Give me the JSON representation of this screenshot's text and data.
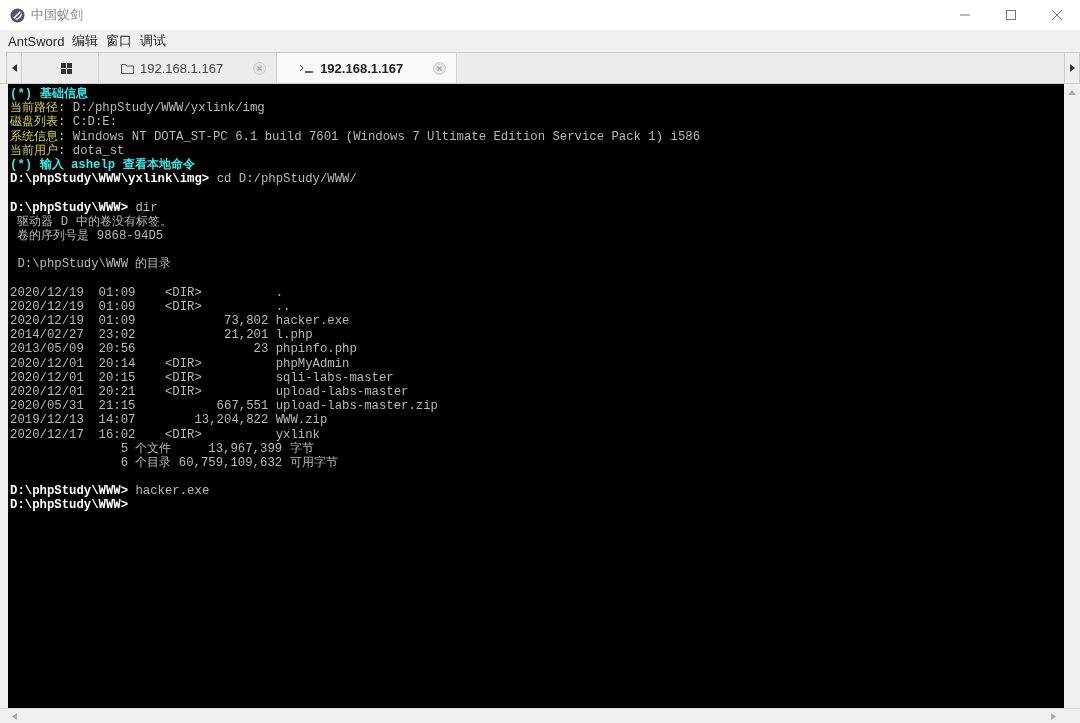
{
  "window": {
    "title": "中国蚁剑"
  },
  "menu": [
    "AntSword",
    "编辑",
    "窗口",
    "调试"
  ],
  "tabs": [
    {
      "kind": "home",
      "selected": false
    },
    {
      "kind": "files",
      "label": "192.168.1.167",
      "selected": false
    },
    {
      "kind": "terminal",
      "label": "192.168.1.167",
      "selected": true
    }
  ],
  "terminal": {
    "lines": [
      {
        "kind": "header",
        "text": "(*) 基础信息"
      },
      {
        "kind": "info",
        "label": "当前路径:",
        "value": "D:/phpStudy/WWW/yxlink/img"
      },
      {
        "kind": "info",
        "label": "磁盘列表:",
        "value": "C:D:E:"
      },
      {
        "kind": "info",
        "label": "系统信息:",
        "value": "Windows NT DOTA_ST-PC 6.1 build 7601 (Windows 7 Ultimate Edition Service Pack 1) i586"
      },
      {
        "kind": "info",
        "label": "当前用户:",
        "value": "dota_st"
      },
      {
        "kind": "header",
        "text": "(*) 输入 ashelp 查看本地命令"
      },
      {
        "kind": "prompt",
        "prompt": "D:\\phpStudy\\WWW\\yxlink\\img>",
        "command": "cd D:/phpStudy/WWW/"
      },
      {
        "kind": "blank"
      },
      {
        "kind": "prompt",
        "prompt": "D:\\phpStudy\\WWW>",
        "command": "dir"
      },
      {
        "kind": "output",
        "text": " 驱动器 D 中的卷没有标签。"
      },
      {
        "kind": "output",
        "text": " 卷的序列号是 9868-94D5"
      },
      {
        "kind": "blank"
      },
      {
        "kind": "output",
        "text": " D:\\phpStudy\\WWW 的目录"
      },
      {
        "kind": "blank"
      },
      {
        "kind": "output",
        "text": "2020/12/19  01:09    <DIR>          ."
      },
      {
        "kind": "output",
        "text": "2020/12/19  01:09    <DIR>          .."
      },
      {
        "kind": "output",
        "text": "2020/12/19  01:09            73,802 hacker.exe"
      },
      {
        "kind": "output",
        "text": "2014/02/27  23:02            21,201 l.php"
      },
      {
        "kind": "output",
        "text": "2013/05/09  20:56                23 phpinfo.php"
      },
      {
        "kind": "output",
        "text": "2020/12/01  20:14    <DIR>          phpMyAdmin"
      },
      {
        "kind": "output",
        "text": "2020/12/01  20:15    <DIR>          sqli-labs-master"
      },
      {
        "kind": "output",
        "text": "2020/12/01  20:21    <DIR>          upload-labs-master"
      },
      {
        "kind": "output",
        "text": "2020/05/31  21:15           667,551 upload-labs-master.zip"
      },
      {
        "kind": "output",
        "text": "2019/12/13  14:07        13,204,822 WWW.zip"
      },
      {
        "kind": "output",
        "text": "2020/12/17  16:02    <DIR>          yxlink"
      },
      {
        "kind": "output",
        "text": "               5 个文件     13,967,399 字节"
      },
      {
        "kind": "output",
        "text": "               6 个目录 60,759,109,632 可用字节"
      },
      {
        "kind": "blank"
      },
      {
        "kind": "prompt",
        "prompt": "D:\\phpStudy\\WWW>",
        "command": "hacker.exe"
      },
      {
        "kind": "prompt",
        "prompt": "D:\\phpStudy\\WWW>"
      }
    ]
  }
}
